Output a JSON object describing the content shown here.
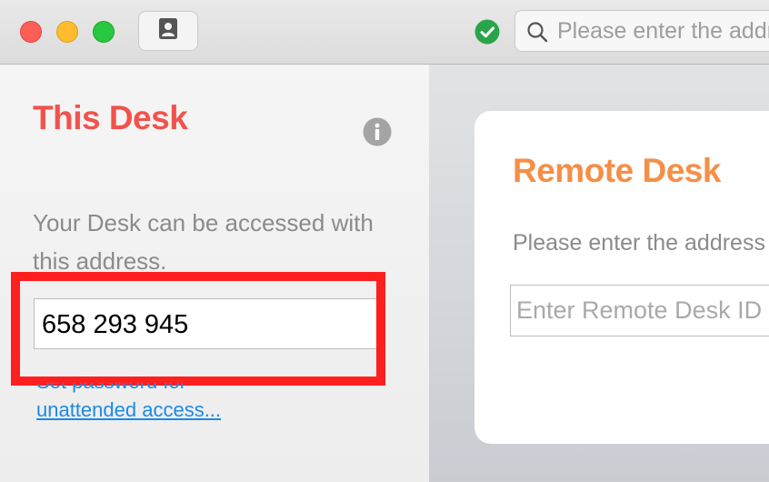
{
  "titlebar": {
    "search_placeholder": "Please enter the address of a remote Desk"
  },
  "this_desk": {
    "title": "This Desk",
    "description": "Your Desk can be accessed with this address.",
    "address": "658 293 945",
    "password_link_line1": "Set password for",
    "password_link_line2": "unattended access..."
  },
  "remote_desk": {
    "title": "Remote Desk",
    "description": "Please enter the address of the remote Desk",
    "input_placeholder": "Enter Remote Desk ID"
  },
  "colors": {
    "this_desk_accent": "#f2524c",
    "remote_desk_accent": "#f58f47",
    "highlight": "#ff1f1f",
    "link": "#1a8ae6",
    "status_ok": "#2aa44b"
  },
  "icons": {
    "address_book": "address-book-icon",
    "status": "checkmark-circle-icon",
    "search": "search-icon",
    "info": "info-icon"
  }
}
